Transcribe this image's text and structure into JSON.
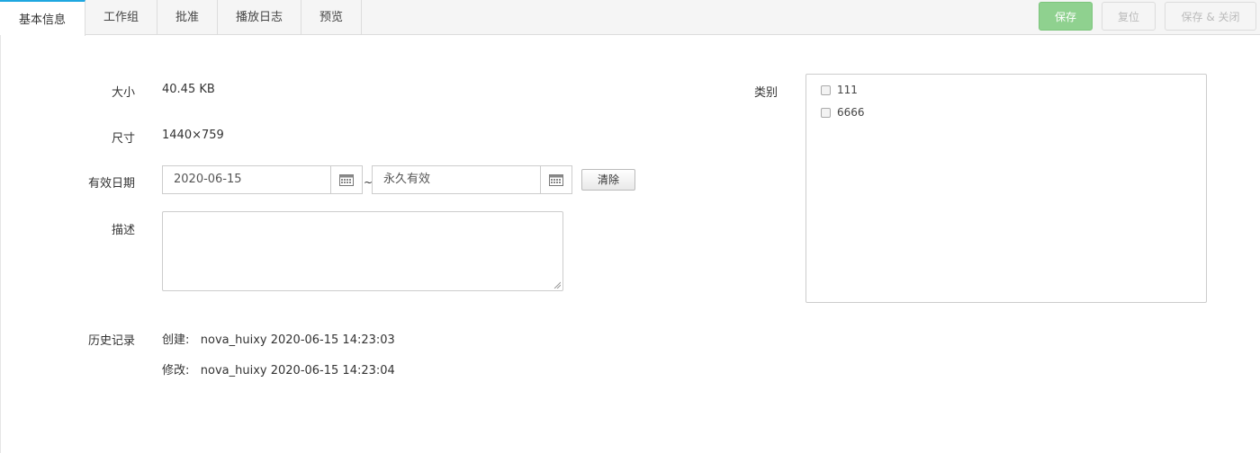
{
  "tabs": [
    {
      "label": "基本信息",
      "active": true
    },
    {
      "label": "工作组",
      "active": false
    },
    {
      "label": "批准",
      "active": false
    },
    {
      "label": "播放日志",
      "active": false
    },
    {
      "label": "预览",
      "active": false
    }
  ],
  "toolbar": {
    "save": "保存",
    "reset": "复位",
    "save_close": "保存 & 关闭"
  },
  "form": {
    "size_label": "大小",
    "size_value": "40.45 KB",
    "dims_label": "尺寸",
    "dims_value": "1440×759",
    "valid_label": "有效日期",
    "start_date": "2020-06-15",
    "tilde": "~",
    "end_date": "永久有效",
    "clear": "清除",
    "desc_label": "描述",
    "history_label": "历史记录",
    "created": "创建:   nova_huixy 2020-06-15 14:23:03",
    "modified": "修改:   nova_huixy 2020-06-15 14:23:04"
  },
  "category": {
    "label": "类别",
    "items": [
      "111",
      "6666"
    ]
  },
  "colors": {
    "accent": "#1fa7e0",
    "save_button": "#8fd18f"
  }
}
